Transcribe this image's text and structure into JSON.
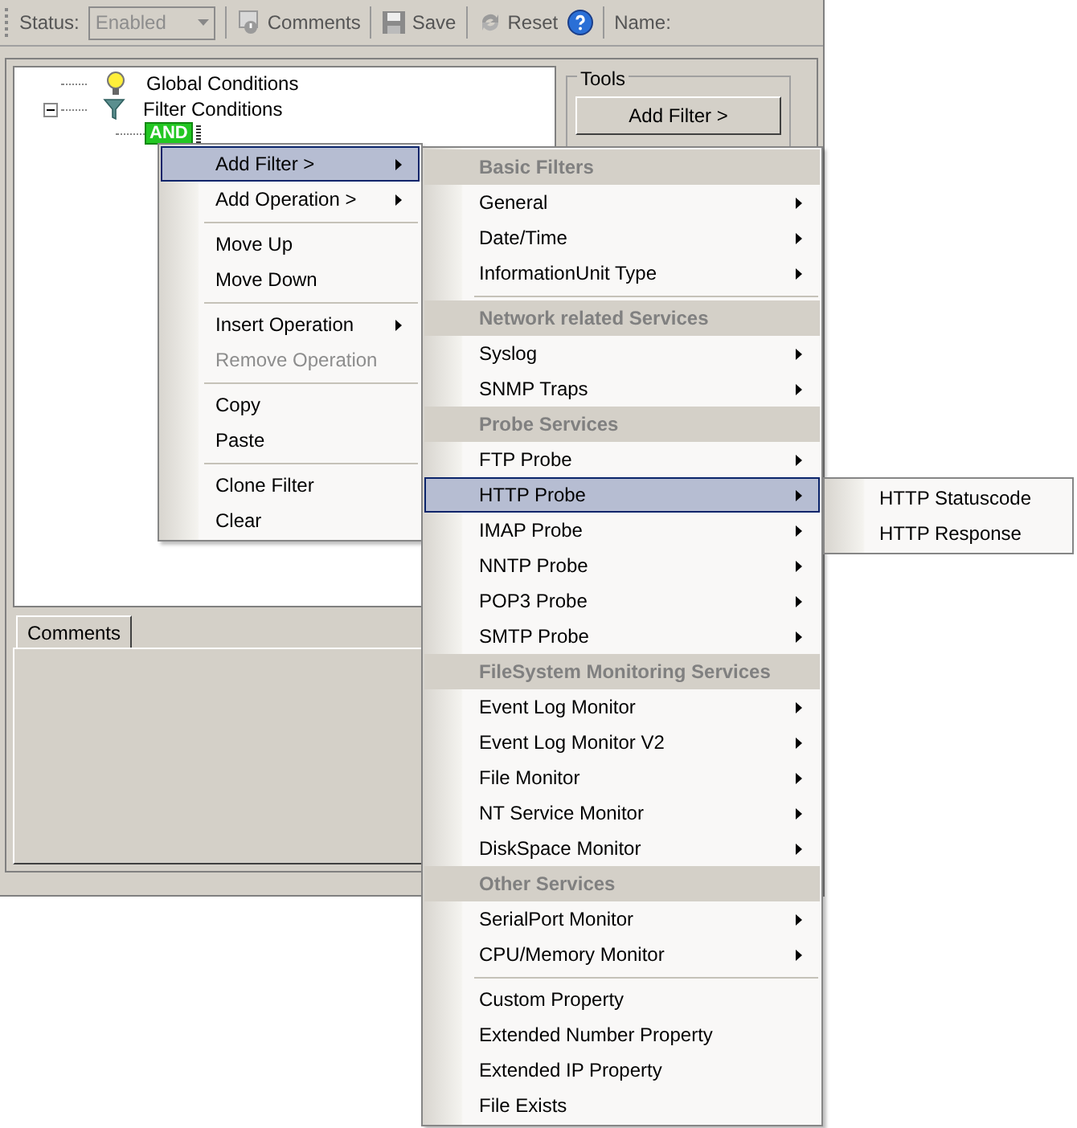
{
  "toolbar": {
    "status_label": "Status:",
    "status_value": "Enabled",
    "status_disabled": true,
    "buttons": [
      {
        "label": "Comments",
        "kind": "comment"
      },
      {
        "label": "Save",
        "kind": "save"
      },
      {
        "label": "Reset",
        "kind": "reset"
      }
    ],
    "name_label": "Name:"
  },
  "tree": [
    {
      "label": "Global Conditions",
      "kind": "bulb"
    },
    {
      "label": "Filter Conditions",
      "kind": "funnel",
      "expanded": true,
      "children": [
        {
          "label": "AND"
        }
      ]
    }
  ],
  "tools": {
    "title": "Tools",
    "button": "Add Filter >"
  },
  "tabs": [
    {
      "label": "Comments",
      "selected": true
    }
  ],
  "context_menu": [
    {
      "kind": "item",
      "label": "Add Filter >",
      "submenu": true,
      "disabled": false,
      "selected": true
    },
    {
      "kind": "item",
      "label": "Add Operation >",
      "submenu": true,
      "disabled": false,
      "selected": false
    },
    {
      "kind": "separator"
    },
    {
      "kind": "item",
      "label": "Move Up",
      "submenu": false,
      "disabled": false,
      "selected": false
    },
    {
      "kind": "item",
      "label": "Move Down",
      "submenu": false,
      "disabled": false,
      "selected": false
    },
    {
      "kind": "separator"
    },
    {
      "kind": "item",
      "label": "Insert Operation",
      "submenu": true,
      "disabled": false,
      "selected": false
    },
    {
      "kind": "item",
      "label": "Remove Operation",
      "submenu": false,
      "disabled": true,
      "selected": false
    },
    {
      "kind": "separator"
    },
    {
      "kind": "item",
      "label": "Copy",
      "submenu": false,
      "disabled": false,
      "selected": false
    },
    {
      "kind": "item",
      "label": "Paste",
      "submenu": false,
      "disabled": false,
      "selected": false
    },
    {
      "kind": "separator"
    },
    {
      "kind": "item",
      "label": "Clone Filter",
      "submenu": false,
      "disabled": false,
      "selected": false
    },
    {
      "kind": "item",
      "label": "Clear",
      "submenu": false,
      "disabled": false,
      "selected": false
    }
  ],
  "filter_menu": [
    {
      "kind": "header",
      "label": "Basic Filters"
    },
    {
      "kind": "item",
      "label": "General",
      "submenu": true,
      "selected": false
    },
    {
      "kind": "item",
      "label": "Date/Time",
      "submenu": true,
      "selected": false
    },
    {
      "kind": "item",
      "label": "InformationUnit Type",
      "submenu": true,
      "selected": false
    },
    {
      "kind": "separator"
    },
    {
      "kind": "header",
      "label": "Network related Services"
    },
    {
      "kind": "item",
      "label": "Syslog",
      "submenu": true,
      "selected": false
    },
    {
      "kind": "item",
      "label": "SNMP Traps",
      "submenu": true,
      "selected": false
    },
    {
      "kind": "header",
      "label": "Probe Services"
    },
    {
      "kind": "item",
      "label": "FTP Probe",
      "submenu": true,
      "selected": false
    },
    {
      "kind": "item",
      "label": "HTTP Probe",
      "submenu": true,
      "selected": true
    },
    {
      "kind": "item",
      "label": "IMAP Probe",
      "submenu": true,
      "selected": false
    },
    {
      "kind": "item",
      "label": "NNTP Probe",
      "submenu": true,
      "selected": false
    },
    {
      "kind": "item",
      "label": "POP3 Probe",
      "submenu": true,
      "selected": false
    },
    {
      "kind": "item",
      "label": "SMTP Probe",
      "submenu": true,
      "selected": false
    },
    {
      "kind": "header",
      "label": "FileSystem Monitoring Services"
    },
    {
      "kind": "item",
      "label": "Event Log Monitor",
      "submenu": true,
      "selected": false
    },
    {
      "kind": "item",
      "label": "Event Log Monitor V2",
      "submenu": true,
      "selected": false
    },
    {
      "kind": "item",
      "label": "File Monitor",
      "submenu": true,
      "selected": false
    },
    {
      "kind": "item",
      "label": "NT Service Monitor",
      "submenu": true,
      "selected": false
    },
    {
      "kind": "item",
      "label": "DiskSpace Monitor",
      "submenu": true,
      "selected": false
    },
    {
      "kind": "header",
      "label": "Other Services"
    },
    {
      "kind": "item",
      "label": "SerialPort Monitor",
      "submenu": true,
      "selected": false
    },
    {
      "kind": "item",
      "label": "CPU/Memory Monitor",
      "submenu": true,
      "selected": false
    },
    {
      "kind": "separator"
    },
    {
      "kind": "item",
      "label": "Custom Property",
      "submenu": false,
      "selected": false
    },
    {
      "kind": "item",
      "label": "Extended Number Property",
      "submenu": false,
      "selected": false
    },
    {
      "kind": "item",
      "label": "Extended IP Property",
      "submenu": false,
      "selected": false
    },
    {
      "kind": "item",
      "label": "File Exists",
      "submenu": false,
      "selected": false
    }
  ],
  "http_menu": [
    {
      "label": "HTTP Statuscode",
      "selected": false
    },
    {
      "label": "HTTP Response",
      "selected": false
    }
  ]
}
